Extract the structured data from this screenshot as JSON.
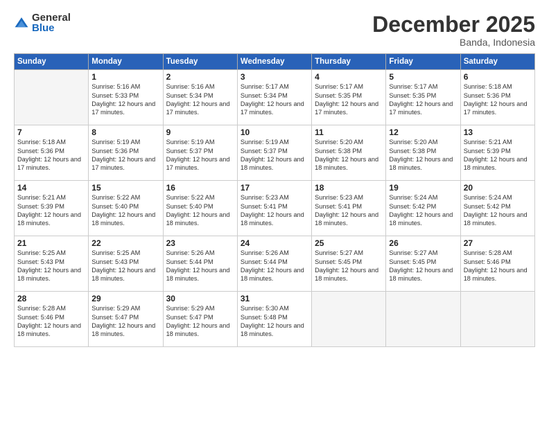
{
  "logo": {
    "general": "General",
    "blue": "Blue"
  },
  "title": "December 2025",
  "subtitle": "Banda, Indonesia",
  "days_of_week": [
    "Sunday",
    "Monday",
    "Tuesday",
    "Wednesday",
    "Thursday",
    "Friday",
    "Saturday"
  ],
  "weeks": [
    [
      {
        "day": "",
        "info": ""
      },
      {
        "day": "1",
        "info": "Sunrise: 5:16 AM\nSunset: 5:33 PM\nDaylight: 12 hours\nand 17 minutes."
      },
      {
        "day": "2",
        "info": "Sunrise: 5:16 AM\nSunset: 5:34 PM\nDaylight: 12 hours\nand 17 minutes."
      },
      {
        "day": "3",
        "info": "Sunrise: 5:17 AM\nSunset: 5:34 PM\nDaylight: 12 hours\nand 17 minutes."
      },
      {
        "day": "4",
        "info": "Sunrise: 5:17 AM\nSunset: 5:35 PM\nDaylight: 12 hours\nand 17 minutes."
      },
      {
        "day": "5",
        "info": "Sunrise: 5:17 AM\nSunset: 5:35 PM\nDaylight: 12 hours\nand 17 minutes."
      },
      {
        "day": "6",
        "info": "Sunrise: 5:18 AM\nSunset: 5:36 PM\nDaylight: 12 hours\nand 17 minutes."
      }
    ],
    [
      {
        "day": "7",
        "info": ""
      },
      {
        "day": "8",
        "info": "Sunrise: 5:19 AM\nSunset: 5:36 PM\nDaylight: 12 hours\nand 17 minutes."
      },
      {
        "day": "9",
        "info": "Sunrise: 5:19 AM\nSunset: 5:37 PM\nDaylight: 12 hours\nand 17 minutes."
      },
      {
        "day": "10",
        "info": "Sunrise: 5:19 AM\nSunset: 5:37 PM\nDaylight: 12 hours\nand 18 minutes."
      },
      {
        "day": "11",
        "info": "Sunrise: 5:20 AM\nSunset: 5:38 PM\nDaylight: 12 hours\nand 18 minutes."
      },
      {
        "day": "12",
        "info": "Sunrise: 5:20 AM\nSunset: 5:38 PM\nDaylight: 12 hours\nand 18 minutes."
      },
      {
        "day": "13",
        "info": "Sunrise: 5:21 AM\nSunset: 5:39 PM\nDaylight: 12 hours\nand 18 minutes."
      }
    ],
    [
      {
        "day": "14",
        "info": ""
      },
      {
        "day": "15",
        "info": "Sunrise: 5:22 AM\nSunset: 5:40 PM\nDaylight: 12 hours\nand 18 minutes."
      },
      {
        "day": "16",
        "info": "Sunrise: 5:22 AM\nSunset: 5:40 PM\nDaylight: 12 hours\nand 18 minutes."
      },
      {
        "day": "17",
        "info": "Sunrise: 5:23 AM\nSunset: 5:41 PM\nDaylight: 12 hours\nand 18 minutes."
      },
      {
        "day": "18",
        "info": "Sunrise: 5:23 AM\nSunset: 5:41 PM\nDaylight: 12 hours\nand 18 minutes."
      },
      {
        "day": "19",
        "info": "Sunrise: 5:24 AM\nSunset: 5:42 PM\nDaylight: 12 hours\nand 18 minutes."
      },
      {
        "day": "20",
        "info": "Sunrise: 5:24 AM\nSunset: 5:42 PM\nDaylight: 12 hours\nand 18 minutes."
      }
    ],
    [
      {
        "day": "21",
        "info": ""
      },
      {
        "day": "22",
        "info": "Sunrise: 5:25 AM\nSunset: 5:43 PM\nDaylight: 12 hours\nand 18 minutes."
      },
      {
        "day": "23",
        "info": "Sunrise: 5:26 AM\nSunset: 5:44 PM\nDaylight: 12 hours\nand 18 minutes."
      },
      {
        "day": "24",
        "info": "Sunrise: 5:26 AM\nSunset: 5:44 PM\nDaylight: 12 hours\nand 18 minutes."
      },
      {
        "day": "25",
        "info": "Sunrise: 5:27 AM\nSunset: 5:45 PM\nDaylight: 12 hours\nand 18 minutes."
      },
      {
        "day": "26",
        "info": "Sunrise: 5:27 AM\nSunset: 5:45 PM\nDaylight: 12 hours\nand 18 minutes."
      },
      {
        "day": "27",
        "info": "Sunrise: 5:28 AM\nSunset: 5:46 PM\nDaylight: 12 hours\nand 18 minutes."
      }
    ],
    [
      {
        "day": "28",
        "info": "Sunrise: 5:28 AM\nSunset: 5:46 PM\nDaylight: 12 hours\nand 18 minutes."
      },
      {
        "day": "29",
        "info": "Sunrise: 5:29 AM\nSunset: 5:47 PM\nDaylight: 12 hours\nand 18 minutes."
      },
      {
        "day": "30",
        "info": "Sunrise: 5:29 AM\nSunset: 5:47 PM\nDaylight: 12 hours\nand 18 minutes."
      },
      {
        "day": "31",
        "info": "Sunrise: 5:30 AM\nSunset: 5:48 PM\nDaylight: 12 hours\nand 18 minutes."
      },
      {
        "day": "",
        "info": ""
      },
      {
        "day": "",
        "info": ""
      },
      {
        "day": "",
        "info": ""
      }
    ]
  ],
  "week1_sunday_info": "Sunrise: 5:18 AM\nSunset: 5:36 PM\nDaylight: 12 hours\nand 17 minutes.",
  "week2_sunday_info": "Sunrise: 5:18 AM\nSunset: 5:36 PM\nDaylight: 12 hours\nand 17 minutes.",
  "week3_sunday_info": "Sunrise: 5:21 AM\nSunset: 5:39 PM\nDaylight: 12 hours\nand 18 minutes.",
  "week4_sunday_info": "Sunrise: 5:21 AM\nSunset: 5:39 PM\nDaylight: 12 hours\nand 18 minutes.",
  "week5_sunday_info": "Sunrise: 5:25 AM\nSunset: 5:43 PM\nDaylight: 12 hours\nand 18 minutes."
}
